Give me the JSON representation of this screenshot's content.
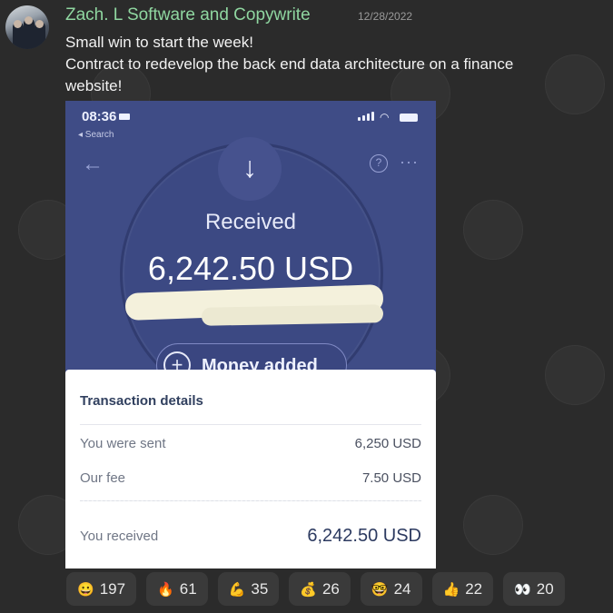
{
  "post": {
    "sender": "Zach. L Software and Copywrite",
    "date": "12/28/2022",
    "lines": [
      "Small win to start the week!",
      "Contract to redevelop the back end data architecture on a finance",
      "website!"
    ]
  },
  "screenshot": {
    "time": "08:36",
    "back_label": "◂ Search",
    "received_label": "Received",
    "amount": "6,242.50 USD",
    "money_added_label": "Money added",
    "card": {
      "title": "Transaction details",
      "rows": [
        {
          "label": "You were sent",
          "value": "6,250 USD"
        },
        {
          "label": "Our fee",
          "value": "7.50 USD"
        },
        {
          "label": "You received",
          "value": "6,242.50 USD"
        }
      ]
    }
  },
  "reactions": [
    {
      "emoji": "😀",
      "icon": "grin-emoji-icon",
      "count": "197"
    },
    {
      "emoji": "🔥",
      "icon": "fire-emoji-icon",
      "count": "61"
    },
    {
      "emoji": "💪",
      "icon": "flexed-bicep-emoji-icon",
      "count": "35"
    },
    {
      "emoji": "💰",
      "icon": "money-bag-emoji-icon",
      "count": "26"
    },
    {
      "emoji": "🤓",
      "icon": "nerd-face-emoji-icon",
      "count": "24"
    },
    {
      "emoji": "👍",
      "icon": "thumbs-up-emoji-icon",
      "count": "22"
    },
    {
      "emoji": "👀",
      "icon": "eyes-emoji-icon",
      "count": "20"
    }
  ]
}
